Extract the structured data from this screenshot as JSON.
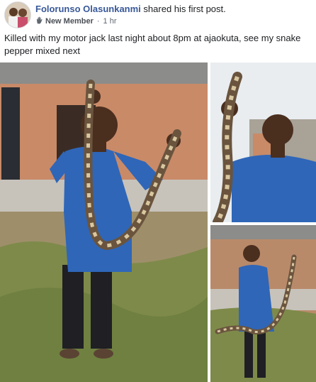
{
  "post": {
    "author": "Folorunso Olasunkanmi",
    "action": "shared his first post.",
    "badge": "New Member",
    "separator": "·",
    "time": "1 hr",
    "text": "Killed with my motor jack last night about 8pm at ajaokuta, see my snake pepper mixed next"
  },
  "photos": {
    "count": 3
  }
}
